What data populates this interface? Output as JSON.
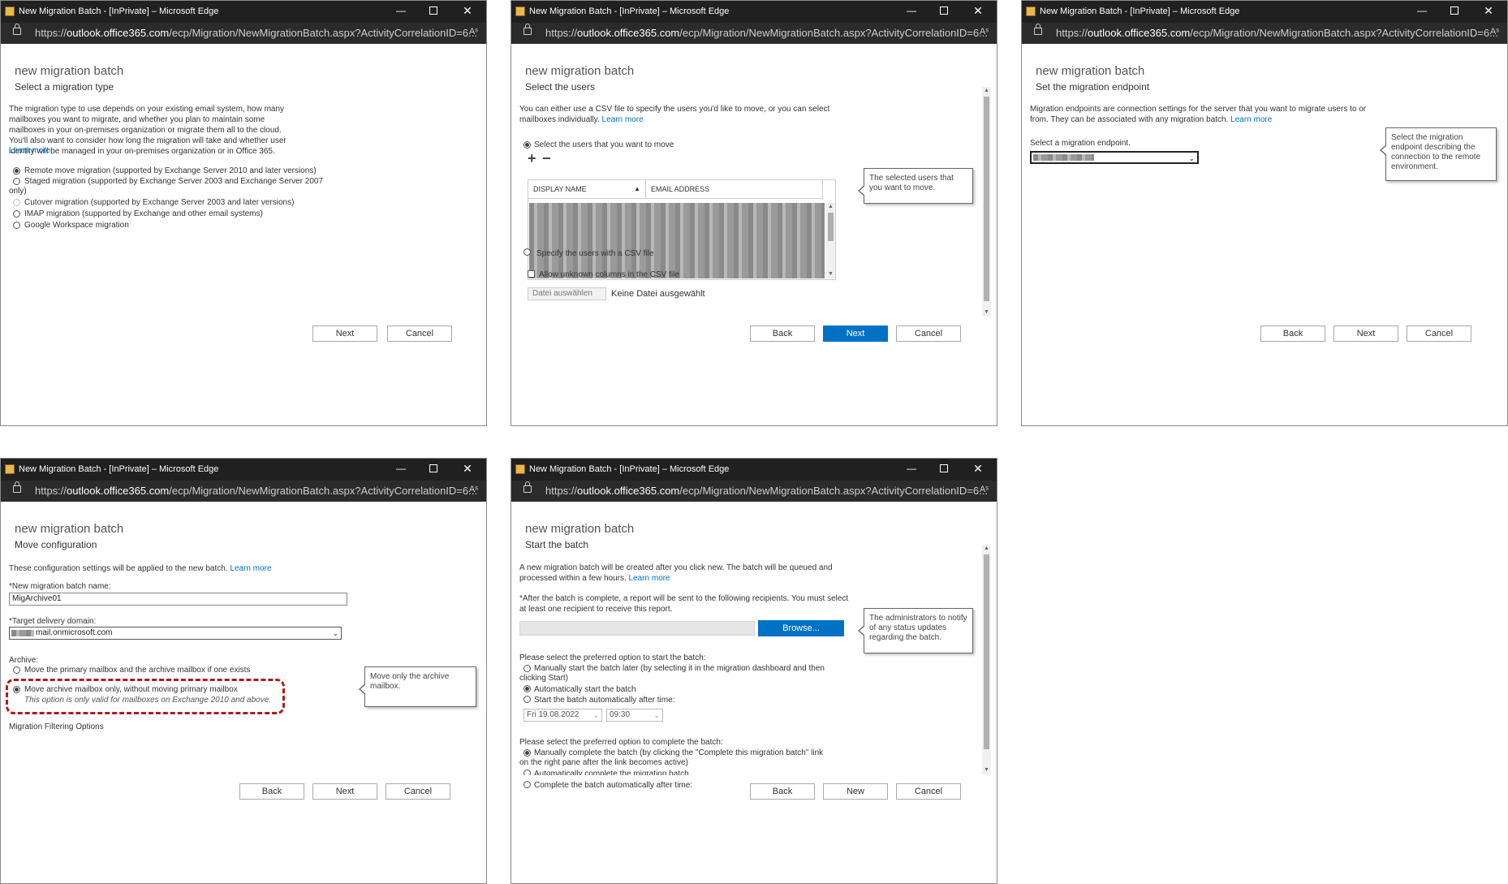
{
  "window_title": "New Migration Batch - [InPrivate] – Microsoft Edge",
  "url_prefix": "https://",
  "url_host": "outlook.office365.com",
  "url_path": "/ecp/Migration/NewMigrationBatch.aspx?ActivityCorrelationID=6...",
  "read_aloud": "Aˢ",
  "header": "new migration batch",
  "buttons": {
    "back": "Back",
    "next": "Next",
    "cancel": "Cancel",
    "new": "New",
    "browse": "Browse..."
  },
  "panel1": {
    "subtitle": "Select a migration type",
    "description": "The migration type to use depends on your existing email system, how many mailboxes you want to migrate, and whether you plan to maintain some mailboxes in your on-premises organization or migrate them all to the cloud. You'll also want to consider how long the migration will take and whether user identity will be managed in your on-premises organization or in Office 365.",
    "learn_more": "Learn more",
    "options": [
      "Remote move migration (supported by Exchange Server 2010 and later versions)",
      "Staged migration (supported by Exchange Server 2003 and Exchange Server 2007",
      "only)",
      "Cutover migration (supported by Exchange Server 2003 and later versions)",
      "IMAP migration (supported by Exchange and other email systems)",
      "Google Workspace migration"
    ]
  },
  "panel2": {
    "subtitle": "Select the users",
    "description": "You can either use a CSV file to specify the users you'd like to move, or you can select mailboxes individually.",
    "learn_more": "Learn more",
    "option_select": "Select the users that you want to move",
    "add": "+",
    "remove": "−",
    "col_display_name": "DISPLAY NAME",
    "col_email": "EMAIL ADDRESS",
    "option_csv": "Specify the users with a CSV file",
    "allow_unknown": "Allow unknown columns in the CSV file",
    "choose_file": "Datei auswählen",
    "no_file": "Keine Datei ausgewählt",
    "callout": "The selected users that you want to move."
  },
  "panel3": {
    "subtitle": "Set the migration endpoint",
    "description": "Migration endpoints are connection settings for the server that you want to migrate users to or from. They can be associated with any migration batch.",
    "learn_more": "Learn more",
    "select_label": "Select a migration endpoint.",
    "callout": "Select the migration endpoint describing the connection to the remote environment."
  },
  "panel4": {
    "subtitle": "Move configuration",
    "description": "These configuration settings will be applied to the new batch.",
    "learn_more": "Learn more",
    "name_label": "*New migration batch name:",
    "name_value": "MigArchive01",
    "domain_label": "*Target delivery domain:",
    "domain_value": "mail.onmicrosoft.com",
    "archive_label": "Archive:",
    "archive_opt1": "Move the primary mailbox and the archive mailbox if one exists",
    "archive_opt2": "Move archive mailbox only, without moving primary mailbox",
    "archive_note": "This option is only valid for mailboxes on Exchange 2010 and above.",
    "filtering": "Migration Filtering Options",
    "callout": "Move only the archive mailbox.",
    "highlight_color": "#b01c1c"
  },
  "panel5": {
    "subtitle": "Start the batch",
    "description": "A new migration batch will be created after you click new. The batch will be queued and processed within a few hours.",
    "learn_more": "Learn more",
    "report_text": "*After the batch is complete, a report will be sent to the following recipients. You must select at least one recipient to receive this report.",
    "start_label": "Please select the preferred option to start the batch:",
    "start_opt1": "Manually start the batch later (by selecting it in the migration dashboard and then",
    "start_opt1b": "clicking Start)",
    "start_opt2": "Automatically start the batch",
    "start_opt3": "Start the batch automatically after time:",
    "date": "Fri 19.08.2022",
    "time": "09:30",
    "complete_label": "Please select the preferred option to complete the batch:",
    "complete_opt1": "Manually complete the batch (by clicking the \"Complete this migration batch\" link",
    "complete_opt1b": "on the right pane after the link becomes active)",
    "complete_opt2": "Automatically complete the migration batch",
    "complete_opt3": "Complete the batch automatically after time:",
    "callout": "The administrators to notify of any status updates regarding the batch."
  },
  "colors": {
    "primary_button": "#0072c6",
    "link": "#0072c6",
    "titlebar": "#202020"
  }
}
